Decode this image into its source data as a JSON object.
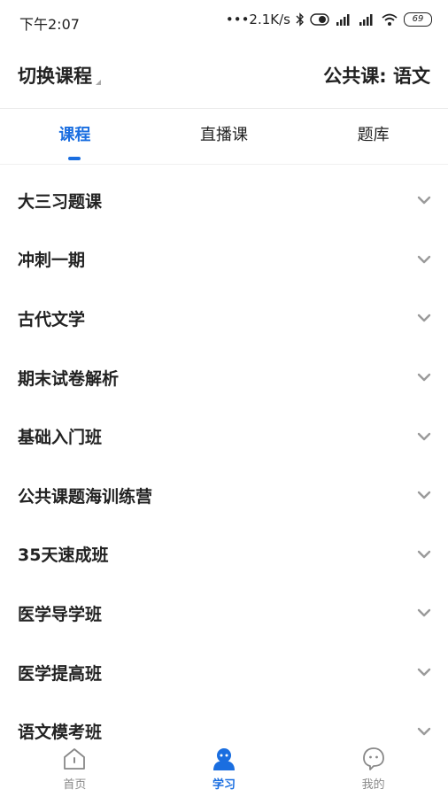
{
  "status_bar": {
    "time": "下午2:07",
    "network_speed": "•••2.1K/s",
    "battery": "69"
  },
  "header": {
    "switch_label": "切换课程",
    "subject_label": "公共课: 语文"
  },
  "tabs": [
    {
      "label": "课程",
      "active": true
    },
    {
      "label": "直播课",
      "active": false
    },
    {
      "label": "题库",
      "active": false
    }
  ],
  "courses": [
    {
      "title": "大三习题课"
    },
    {
      "title": "冲刺一期"
    },
    {
      "title": "古代文学"
    },
    {
      "title": "期末试卷解析"
    },
    {
      "title": "基础入门班"
    },
    {
      "title": "公共课题海训练营"
    },
    {
      "title": "35天速成班"
    },
    {
      "title": "医学导学班"
    },
    {
      "title": "医学提高班"
    },
    {
      "title": "语文模考班"
    }
  ],
  "bottom_nav": [
    {
      "label": "首页",
      "icon": "home-icon",
      "active": false
    },
    {
      "label": "学习",
      "icon": "study-icon",
      "active": true
    },
    {
      "label": "我的",
      "icon": "profile-icon",
      "active": false
    }
  ],
  "colors": {
    "accent": "#1a6ee0",
    "text": "#222222",
    "muted": "#888888",
    "chevron": "#9a9a9a"
  }
}
